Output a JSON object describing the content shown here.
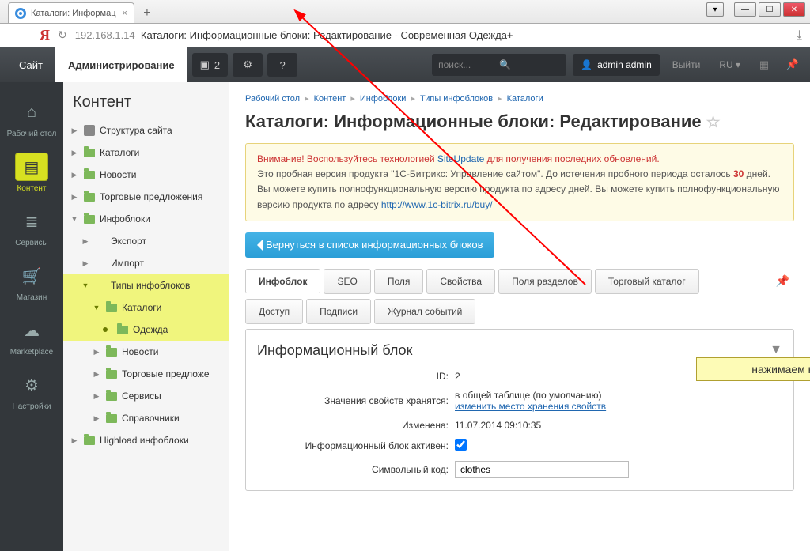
{
  "browser": {
    "tab_title": "Каталоги: Информац",
    "ip": "192.168.1.14",
    "page_title_suffix": "Каталоги: Информационные блоки: Редактирование - Современная Одежда+"
  },
  "topbar": {
    "site": "Сайт",
    "admin": "Администрирование",
    "notif_count": "2",
    "search_placeholder": "поиск...",
    "user": "admin admin",
    "logout": "Выйти",
    "lang": "RU"
  },
  "rail": [
    {
      "label": "Рабочий стол",
      "icon": "home"
    },
    {
      "label": "Контент",
      "icon": "doc",
      "active": true
    },
    {
      "label": "Сервисы",
      "icon": "layers"
    },
    {
      "label": "Магазин",
      "icon": "cart"
    },
    {
      "label": "Marketplace",
      "icon": "cloud"
    },
    {
      "label": "Настройки",
      "icon": "gear"
    }
  ],
  "sidebar": {
    "title": "Контент",
    "tree": {
      "struct": "Структура сайта",
      "catalogs": "Каталоги",
      "news": "Новости",
      "offers": "Торговые предложения",
      "iblocks": "Инфоблоки",
      "export": "Экспорт",
      "import": "Импорт",
      "types": "Типы инфоблоков",
      "cat": "Каталоги",
      "clothes": "Одежда",
      "t_news": "Новости",
      "t_offers": "Торговые предложе",
      "t_services": "Сервисы",
      "t_ref": "Справочники",
      "highload": "Highload инфоблоки"
    }
  },
  "breadcrumb": [
    "Рабочий стол",
    "Контент",
    "Инфоблоки",
    "Типы инфоблоков",
    "Каталоги"
  ],
  "page_title": "Каталоги: Информационные блоки: Редактирование",
  "alert": {
    "warn": "Внимание! Воспользуйтесь технологией ",
    "link1": "SiteUpdate",
    "tail1": " для получения последних обновлений.",
    "line2a": "Это пробная версия продукта \"1С-Битрикс: Управление сайтом\". До истечения пробного периода осталось ",
    "days": "30",
    "line2b": " дней. Вы можете купить полнофункциональную версию продукта по адресу ",
    "link2": "http://www.1c-bitrix.ru/buy/"
  },
  "back_button": "Вернуться в список информационных блоков",
  "tabs1": [
    "Инфоблок",
    "SEO",
    "Поля",
    "Свойства",
    "Поля разделов",
    "Торговый каталог"
  ],
  "tabs2": [
    "Доступ",
    "Подписи",
    "Журнал событий"
  ],
  "panel_title": "Информационный блок",
  "form": {
    "id_label": "ID:",
    "id_val": "2",
    "props_label": "Значения свойств хранятся:",
    "props_val": "в общей таблице (по умолчанию)",
    "props_link": "изменить место хранения свойств",
    "changed_label": "Изменена:",
    "changed_val": "11.07.2014 09:10:35",
    "active_label": "Информационный блок активен:",
    "code_label": "Символьный код:",
    "code_val": "clothes"
  },
  "annotation": "нажимаем на Настройки"
}
